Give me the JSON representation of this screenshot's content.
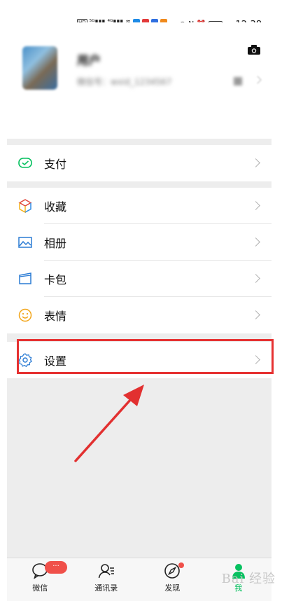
{
  "status_bar": {
    "time": "12:38",
    "left_icons": [
      "HD",
      "5G",
      "4G",
      "wifi",
      "apps"
    ]
  },
  "profile": {
    "nickname": "用户",
    "wechat_id": "微信号：wxid_1234567"
  },
  "menu": {
    "pay": "支付",
    "favorites": "收藏",
    "album": "相册",
    "cards": "卡包",
    "stickers": "表情",
    "settings": "设置"
  },
  "tabs": [
    {
      "label": "微信",
      "badge": "···"
    },
    {
      "label": "通讯录"
    },
    {
      "label": "发现"
    },
    {
      "label": "我"
    }
  ],
  "colors": {
    "accent": "#07c160",
    "highlight": "#e63232",
    "badge": "#f0504a"
  },
  "watermark": "Bai 经验"
}
